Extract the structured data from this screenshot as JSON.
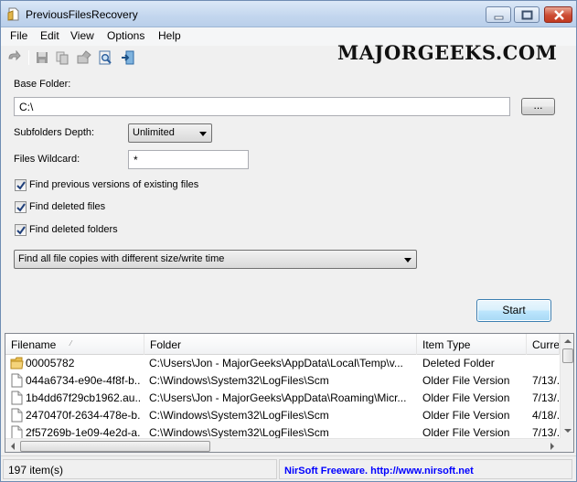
{
  "window": {
    "title": "PreviousFilesRecovery",
    "watermark": "MAJORGEEKS.COM"
  },
  "menu": [
    "File",
    "Edit",
    "View",
    "Options",
    "Help"
  ],
  "toolbar": {
    "icons": [
      "refresh-icon",
      "save-icon",
      "copy-icon",
      "export-icon",
      "find-icon",
      "exit-icon"
    ]
  },
  "form": {
    "base_folder_label": "Base Folder:",
    "base_folder_value": "C:\\",
    "browse_label": "...",
    "depth_label": "Subfolders Depth:",
    "depth_value": "Unlimited",
    "wildcard_label": "Files Wildcard:",
    "wildcard_value": "*",
    "checkboxes": [
      {
        "label": "Find previous versions of existing files",
        "checked": true
      },
      {
        "label": "Find deleted files",
        "checked": true
      },
      {
        "label": "Find deleted folders",
        "checked": true
      }
    ],
    "mode_value": "Find all file copies with different size/write time",
    "start_label": "Start"
  },
  "list": {
    "columns": [
      "Filename",
      "Folder",
      "Item Type",
      "Curre"
    ],
    "rows": [
      {
        "icon": "folder-icon",
        "filename": "00005782",
        "folder": "C:\\Users\\Jon - MajorGeeks\\AppData\\Local\\Temp\\v...",
        "type": "Deleted Folder",
        "current": ""
      },
      {
        "icon": "file-icon",
        "filename": "044a6734-e90e-4f8f-b...",
        "folder": "C:\\Windows\\System32\\LogFiles\\Scm",
        "type": "Older File Version",
        "current": "7/13/..."
      },
      {
        "icon": "file-icon",
        "filename": "1b4dd67f29cb1962.au...",
        "folder": "C:\\Users\\Jon - MajorGeeks\\AppData\\Roaming\\Micr...",
        "type": "Older File Version",
        "current": "7/13/..."
      },
      {
        "icon": "file-icon",
        "filename": "2470470f-2634-478e-b...",
        "folder": "C:\\Windows\\System32\\LogFiles\\Scm",
        "type": "Older File Version",
        "current": "4/18/..."
      },
      {
        "icon": "file-icon",
        "filename": "2f57269b-1e09-4e2d-a...",
        "folder": "C:\\Windows\\System32\\LogFiles\\Scm",
        "type": "Older File Version",
        "current": "7/13/..."
      }
    ]
  },
  "status": {
    "count": "197 item(s)",
    "nirsoft": "NirSoft Freeware.  http://www.nirsoft.net"
  }
}
